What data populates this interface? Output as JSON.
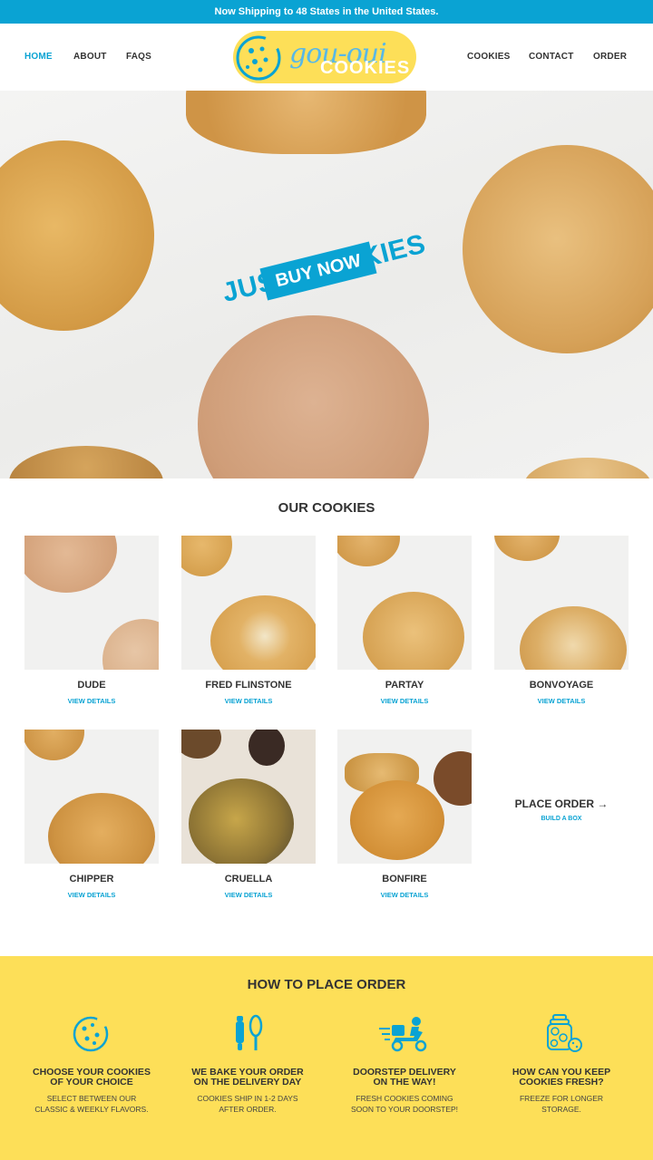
{
  "announcement": "Now Shipping to 48 States in the United States.",
  "nav": {
    "left": [
      "HOME",
      "ABOUT",
      "FAQS"
    ],
    "right": [
      "COOKIES",
      "CONTACT",
      "ORDER"
    ]
  },
  "logo": {
    "word1": "gou-oui",
    "word2": "COOKIES"
  },
  "hero": {
    "headline": "JUST COOKIES",
    "cta": "BUY NOW"
  },
  "our_cookies": {
    "title": "OUR COOKIES",
    "items": [
      {
        "name": "DUDE",
        "link": "VIEW DETAILS"
      },
      {
        "name": "FRED FLINSTONE",
        "link": "VIEW DETAILS"
      },
      {
        "name": "PARTAY",
        "link": "VIEW DETAILS"
      },
      {
        "name": "BONVOYAGE",
        "link": "VIEW DETAILS"
      },
      {
        "name": "CHIPPER",
        "link": "VIEW DETAILS"
      },
      {
        "name": "CRUELLA",
        "link": "VIEW DETAILS"
      },
      {
        "name": "BONFIRE",
        "link": "VIEW DETAILS"
      }
    ],
    "place_order": {
      "title": "PLACE ORDER →",
      "sub": "BUILD A BOX"
    }
  },
  "how_to": {
    "title": "HOW TO PLACE ORDER",
    "steps": [
      {
        "icon": "cookie-icon",
        "title_1": "CHOOSE YOUR COOKIES",
        "title_2": "OF YOUR CHOICE",
        "desc_1": "SELECT BETWEEN OUR",
        "desc_2": "CLASSIC & WEEKLY FLAVORS."
      },
      {
        "icon": "baking-tools-icon",
        "title_1": "WE BAKE YOUR ORDER",
        "title_2": "ON THE DELIVERY DAY",
        "desc_1": "COOKIES SHIP IN 1-2 DAYS",
        "desc_2": "AFTER ORDER."
      },
      {
        "icon": "delivery-scooter-icon",
        "title_1": "DOORSTEP DELIVERY",
        "title_2": "ON THE WAY!",
        "desc_1": "FRESH COOKIES COMING",
        "desc_2": "SOON TO YOUR DOORSTEP!"
      },
      {
        "icon": "cookie-jar-icon",
        "title_1": "HOW CAN YOU KEEP",
        "title_2": "COOKIES FRESH?",
        "desc_1": "FREEZE FOR LONGER",
        "desc_2": "STORAGE."
      }
    ]
  },
  "colors": {
    "brand_blue": "#0aa3d3",
    "brand_yellow": "#fddf58",
    "text_dark": "#333333"
  }
}
